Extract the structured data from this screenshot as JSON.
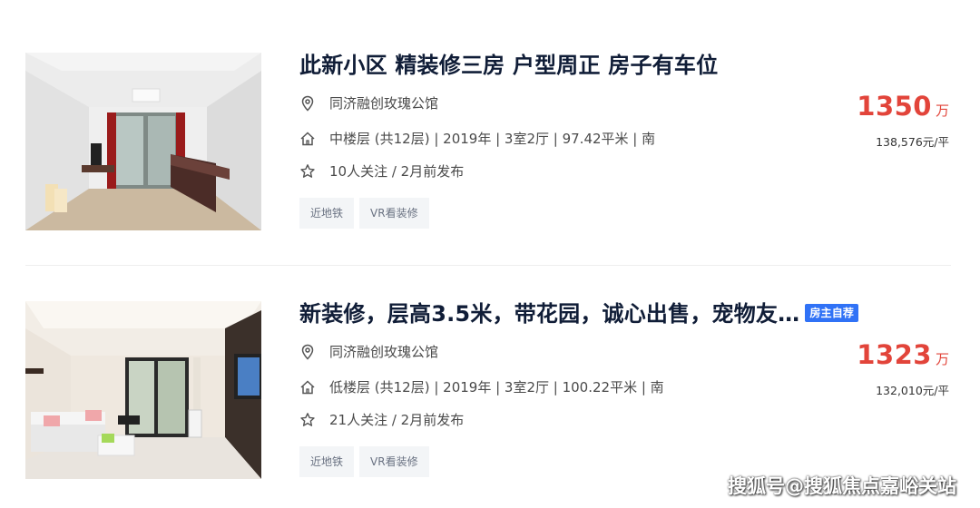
{
  "listings": [
    {
      "title": "此新小区 精装修三房 户型周正 房子有车位",
      "badge": "",
      "community": "同济融创玫瑰公馆",
      "info": "中楼层 (共12层) | 2019年 | 3室2厅 | 97.42平米 | 南",
      "follow": "10人关注 / 2月前发布",
      "tags": [
        "近地铁",
        "VR看装修"
      ],
      "price": "1350",
      "price_unit": "万",
      "unit_price": "138,576元/平"
    },
    {
      "title": "新装修，层高3.5米，带花园，诚心出售，宠物友…",
      "badge": "房主自荐",
      "community": "同济融创玫瑰公馆",
      "info": "低楼层 (共12层) | 2019年 | 3室2厅 | 100.22平米 | 南",
      "follow": "21人关注 / 2月前发布",
      "tags": [
        "近地铁",
        "VR看装修"
      ],
      "price": "1323",
      "price_unit": "万",
      "unit_price": "132,010元/平"
    }
  ],
  "icons": {
    "location": "location-pin-icon",
    "house": "house-icon",
    "follow": "star-icon"
  },
  "colors": {
    "price": "#e2443a",
    "title": "#101d37",
    "badge": "#3072f6",
    "tag_bg": "#f3f5f7"
  },
  "watermark": "搜狐号@搜狐焦点嘉峪关站"
}
